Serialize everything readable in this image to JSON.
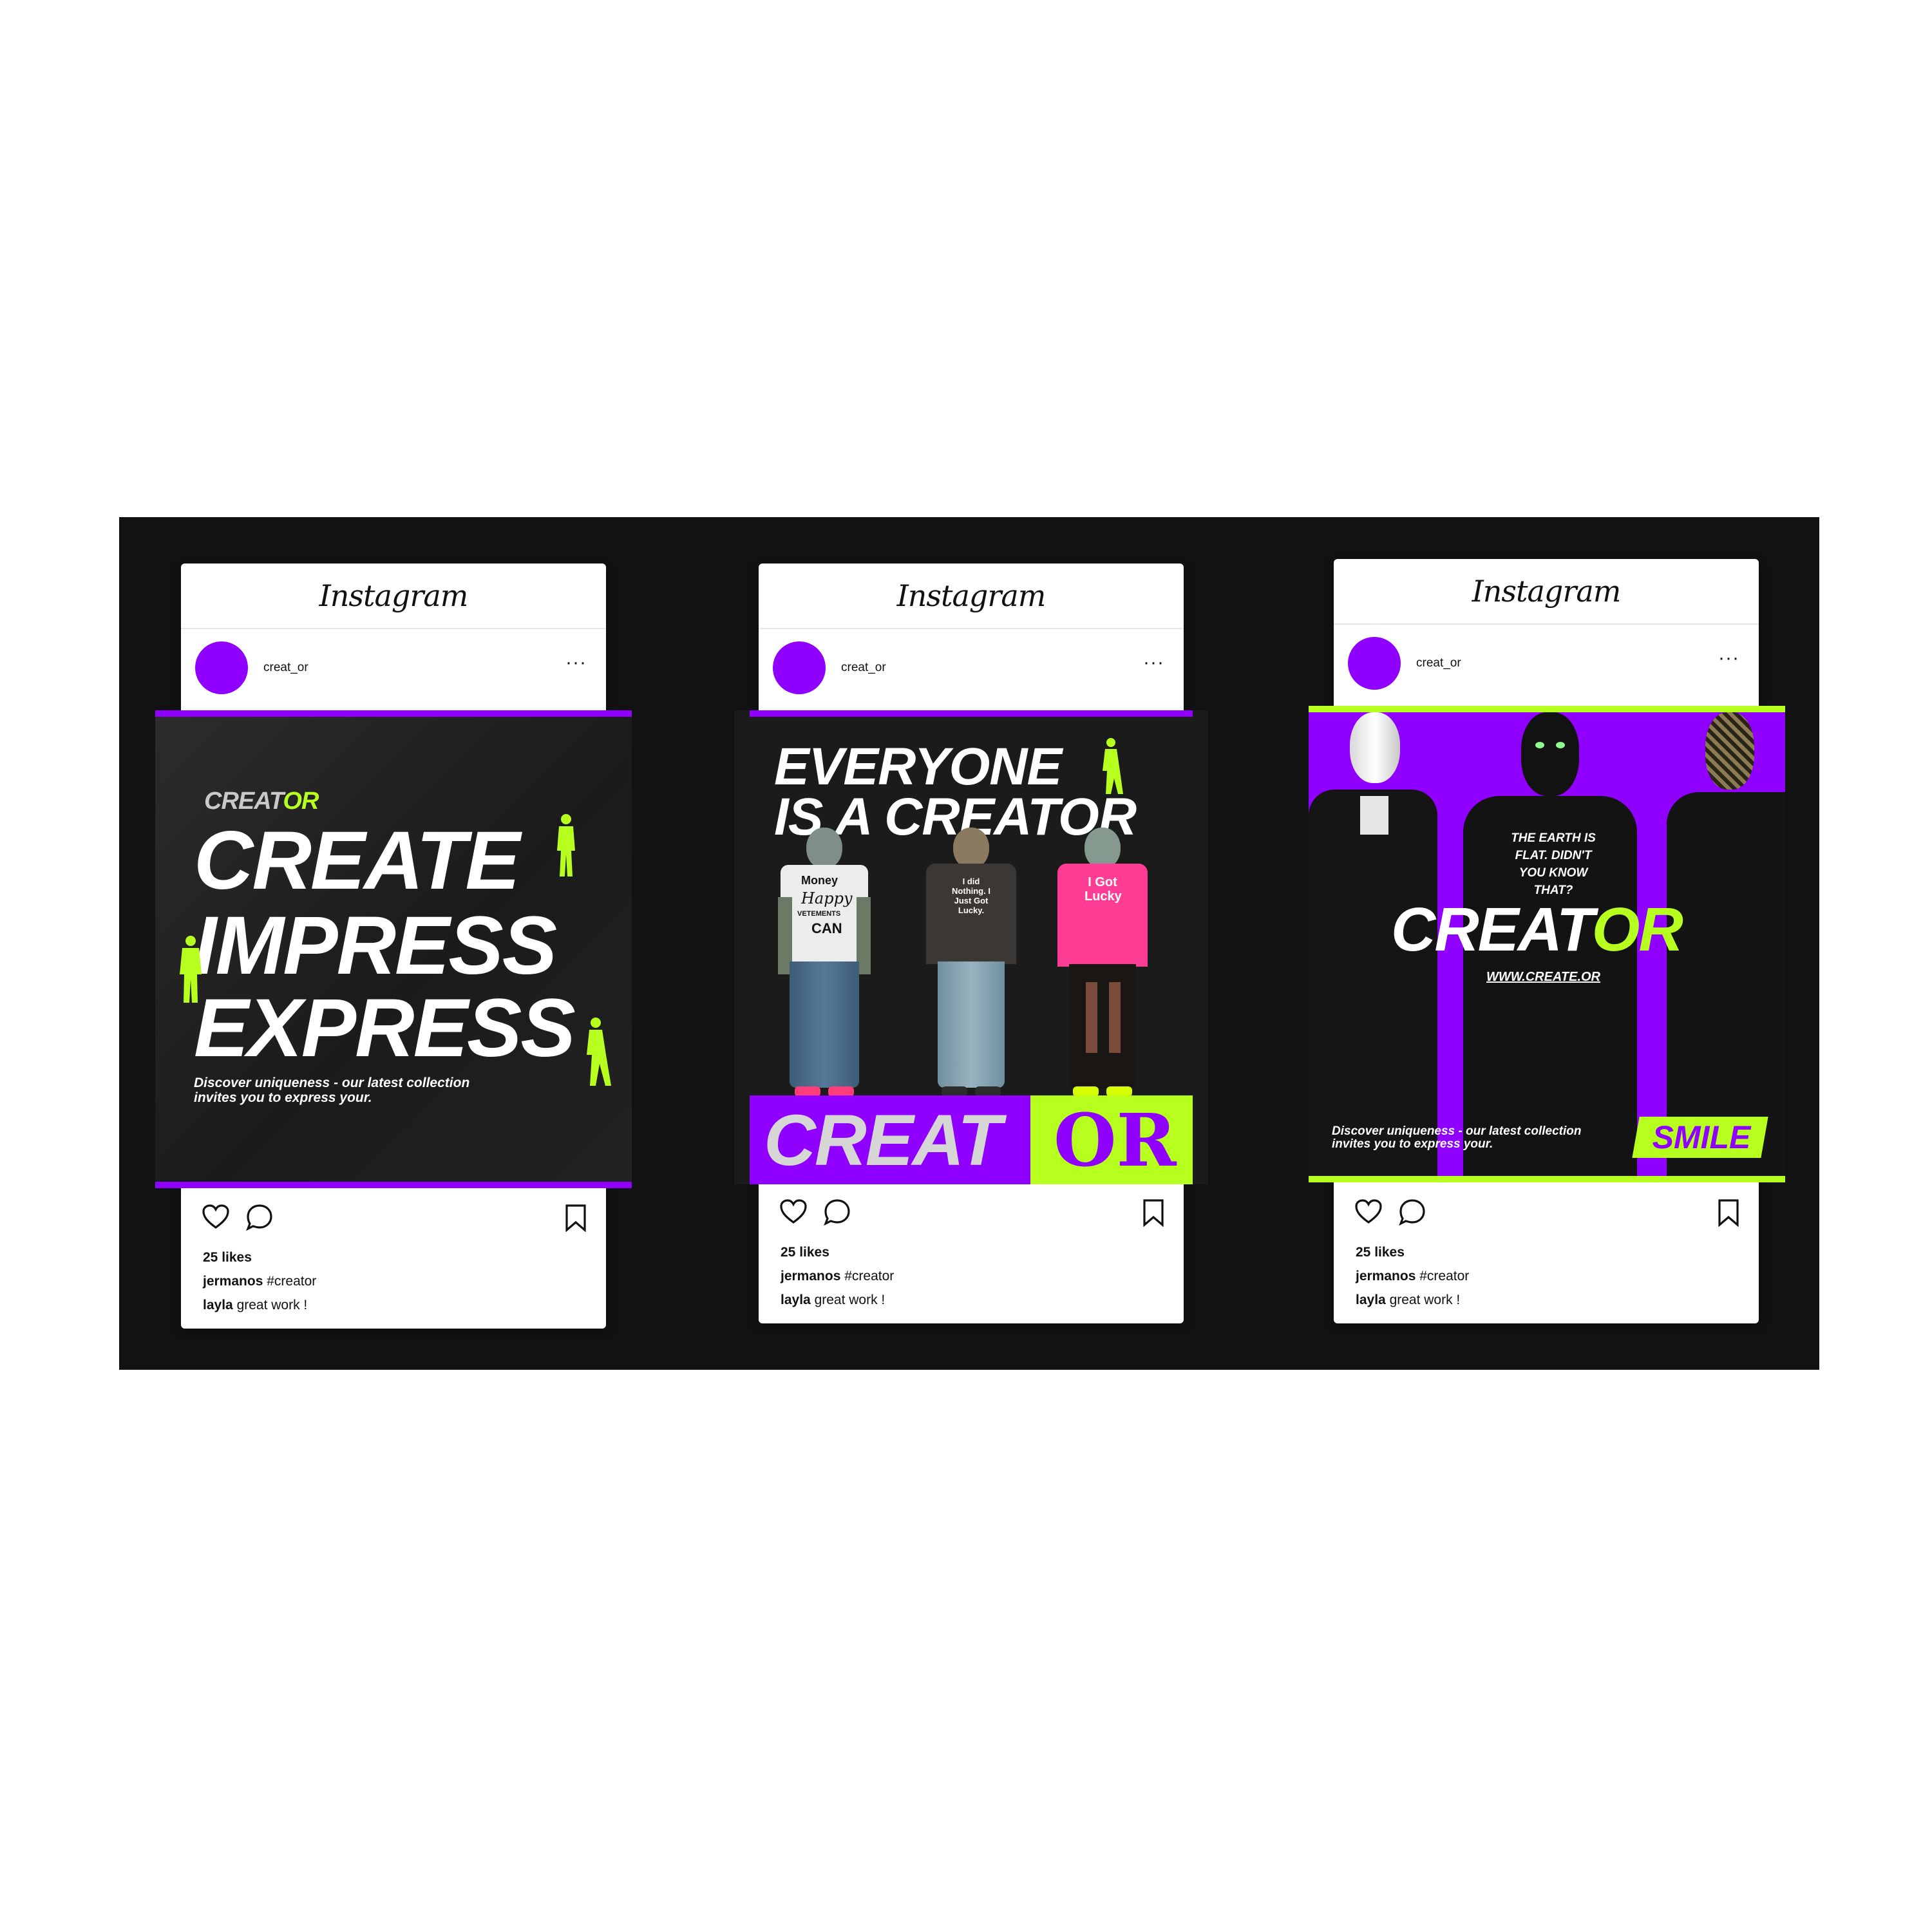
{
  "brand": {
    "purple": "#8f00ff",
    "lime": "#b6ff1e",
    "dark": "#161616"
  },
  "app_name": "Instagram",
  "posts": [
    {
      "username": "creat_or",
      "more": "···",
      "likes": "25 likes",
      "caption_user": "jermanos",
      "caption_text": "#creator",
      "comment_user": "layla",
      "comment_text": "great work !",
      "image": {
        "brand_a": "CREAT",
        "brand_b": "OR",
        "line1": "CREATE",
        "line2": "IMPRESS",
        "line3": "EXPRESS",
        "desc1": "Discover uniqueness - our latest collection",
        "desc2": "invites you to express your."
      }
    },
    {
      "username": "creat_or",
      "more": "···",
      "likes": "25 likes",
      "caption_user": "jermanos",
      "caption_text": "#creator",
      "comment_user": "layla",
      "comment_text": "great work !",
      "image": {
        "headline1": "EVERYONE",
        "headline2": "IS A CREATOR",
        "banner_a": "CREAT",
        "banner_b": "OR",
        "shirt1_a": "Money",
        "shirt1_b": "Happy",
        "shirt1_c": "VETEMENTS",
        "shirt1_d": "CAN",
        "shirt2": "I did Nothing. I Just Got Lucky.",
        "shirt3": "I Got Lucky"
      }
    },
    {
      "username": "creat_or",
      "more": "···",
      "likes": "25 likes",
      "caption_user": "jermanos",
      "caption_text": "#creator",
      "comment_user": "layla",
      "comment_text": "great work !",
      "image": {
        "brand_a": "CREAT",
        "brand_b": "OR",
        "url": "WWW.CREATE.OR",
        "shirt": "THE EARTH IS FLAT. DIDN'T YOU KNOW THAT?",
        "desc1": "Discover uniqueness - our latest collection",
        "desc2": "invites you to express your.",
        "badge": "SMILE"
      }
    }
  ]
}
